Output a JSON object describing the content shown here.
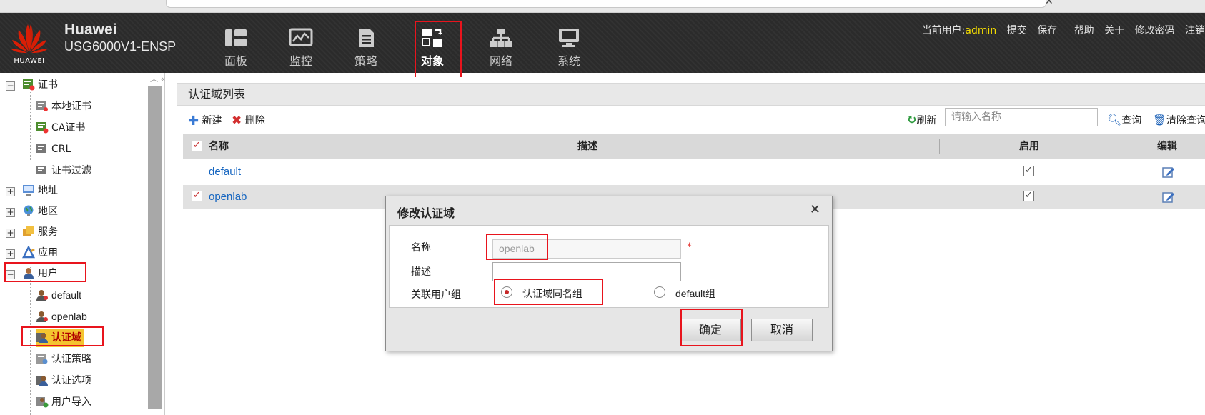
{
  "header": {
    "brand_name": "Huawei",
    "brand_model": "USG6000V1-ENSP",
    "logo_text": "HUAWEI",
    "nav": [
      {
        "label": "面板",
        "icon": "dashboard-icon"
      },
      {
        "label": "监控",
        "icon": "monitor-icon"
      },
      {
        "label": "策略",
        "icon": "policy-icon"
      },
      {
        "label": "对象",
        "icon": "object-icon",
        "active": true
      },
      {
        "label": "网络",
        "icon": "network-icon"
      },
      {
        "label": "系统",
        "icon": "system-icon"
      }
    ],
    "current_user_label": "当前用户:",
    "current_user": "admin",
    "links": [
      "提交",
      "保存",
      "帮助",
      "关于",
      "修改密码",
      "注销"
    ]
  },
  "sidebar": {
    "items": [
      {
        "label": "证书",
        "icon": "certificate-icon",
        "toggle": "−"
      },
      {
        "label": "本地证书",
        "icon": "local-cert-icon"
      },
      {
        "label": "CA证书",
        "icon": "ca-cert-icon"
      },
      {
        "label": "CRL",
        "icon": "crl-icon"
      },
      {
        "label": "证书过滤",
        "icon": "cert-filter-icon"
      },
      {
        "label": "地址",
        "icon": "address-icon",
        "toggle": "+"
      },
      {
        "label": "地区",
        "icon": "region-icon",
        "toggle": "+"
      },
      {
        "label": "服务",
        "icon": "service-icon",
        "toggle": "+"
      },
      {
        "label": "应用",
        "icon": "application-icon",
        "toggle": "+"
      },
      {
        "label": "用户",
        "icon": "user-icon",
        "toggle": "−"
      },
      {
        "label": "default",
        "icon": "user-default-icon"
      },
      {
        "label": "openlab",
        "icon": "user-openlab-icon"
      },
      {
        "label": "认证域",
        "icon": "auth-domain-icon",
        "selected": true
      },
      {
        "label": "认证策略",
        "icon": "auth-policy-icon"
      },
      {
        "label": "认证选项",
        "icon": "auth-option-icon"
      },
      {
        "label": "用户导入",
        "icon": "user-import-icon"
      }
    ]
  },
  "panel": {
    "title": "认证域列表",
    "toolbar": {
      "new_label": "新建",
      "delete_label": "删除",
      "refresh_label": "刷新",
      "search_placeholder": "请输入名称",
      "query_label": "查询",
      "clear_label": "清除查询"
    },
    "table": {
      "columns": [
        "名称",
        "描述",
        "启用",
        "编辑"
      ],
      "rows": [
        {
          "name": "default",
          "desc": "",
          "enabled": true,
          "checked": false
        },
        {
          "name": "openlab",
          "desc": "",
          "enabled": true,
          "checked": true
        }
      ]
    }
  },
  "dialog": {
    "title": "修改认证域",
    "name_label": "名称",
    "name_value": "openlab",
    "required_mark": "*",
    "desc_label": "描述",
    "desc_value": "",
    "group_label": "关联用户组",
    "group_options": [
      {
        "label": "认证域同名组",
        "selected": true
      },
      {
        "label": "default组",
        "selected": false
      }
    ],
    "ok_label": "确定",
    "cancel_label": "取消"
  },
  "colors": {
    "header_bg": "#2b2b2b",
    "user_highlight": "#f4dc00",
    "link_blue": "#1565c0",
    "annotation_red": "#e8141d",
    "huawei_red": "#d81e06"
  }
}
